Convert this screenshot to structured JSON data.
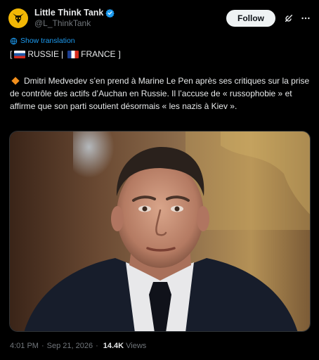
{
  "author": {
    "display_name": "Little Think Tank",
    "handle": "@L_ThinkTank",
    "avatar_icon": "bull-skull-logo",
    "avatar_color": "#f2b705",
    "verified_color": "#1d9bf0"
  },
  "actions": {
    "follow_label": "Follow",
    "grok_icon": "grok-icon",
    "more_icon": "more-icon"
  },
  "translation": {
    "label": "Show translation"
  },
  "tags": {
    "open": "[",
    "country1": "RUSSIE",
    "separator": "|",
    "country2": "FRANCE",
    "close": "]"
  },
  "body": {
    "text": "Dmitri Medvedev s’en prend à Marine Le Pen après ses critiques sur la prise de contrôle des actifs d’Auchan en Russie. Il l’accuse de « russophobie » et affirme que son parti soutient désormais « les nazis à Kiev »."
  },
  "meta": {
    "time": "4:01 PM",
    "dot": "·",
    "date": "Sep 21, 2026",
    "dot2": "·",
    "views_count": "14.4K",
    "views_label": "Views"
  },
  "colors": {
    "background": "#000000",
    "text": "#e7e9ea",
    "muted": "#71767b",
    "link": "#1d9bf0"
  }
}
